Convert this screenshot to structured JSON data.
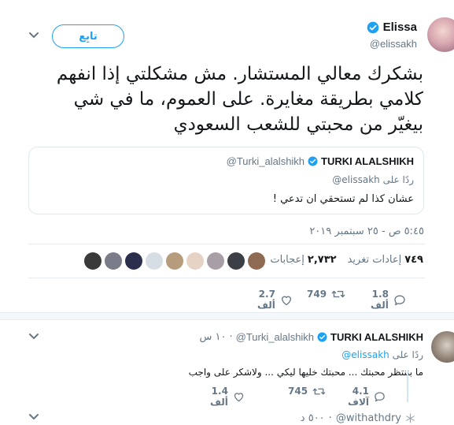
{
  "tweet": {
    "display_name": "Elissa",
    "handle": "@elissakh",
    "follow_label": "تابِع",
    "text": "بشكرك معالي المستشار. مش مشكلتي إذا انفهم كلامي بطريقة مغايرة. على العموم، ما في شي بيغيّر من محبتي للشعب السعودي",
    "timestamp": "٥:٤٥ ص - ٢٥ سبتمبر ٢٠١٩",
    "quoted": {
      "display_name": "TURKI ALALSHIKH",
      "handle": "@Turki_alalshikh",
      "reply_prefix": "ردًا على",
      "reply_to": "@elissakh",
      "text": "عشان كذا لم تستحقي ان تدعي !"
    },
    "stats": {
      "retweets_count": "٧٤٩",
      "retweets_label": "إعادات تغريد",
      "likes_count": "٢,٧٣٢",
      "likes_label": "إعجابات"
    },
    "actions": {
      "reply_count": "1.8 ألف",
      "retweet_count": "749",
      "like_count": "2.7 ألف"
    }
  },
  "reply": {
    "display_name": "TURKI ALALSHIKH",
    "handle": "@Turki_alalshikh",
    "time": "١٠ س",
    "reply_prefix": "ردًا على",
    "reply_to": "@elissakh",
    "text": "ما بننتظر محبتك ... محبتك خليها ليكي ... ولاشكر على واجب",
    "actions": {
      "reply_count": "4.1 آلاف",
      "retweet_count": "745",
      "like_count": "1.4 ألف"
    }
  },
  "next": {
    "handle": "@withathdry",
    "time": "٥٠٠ د"
  },
  "colors": {
    "accent": "#1da1f2",
    "text": "#14171a",
    "muted": "#657786",
    "border": "#e1e8ed"
  }
}
